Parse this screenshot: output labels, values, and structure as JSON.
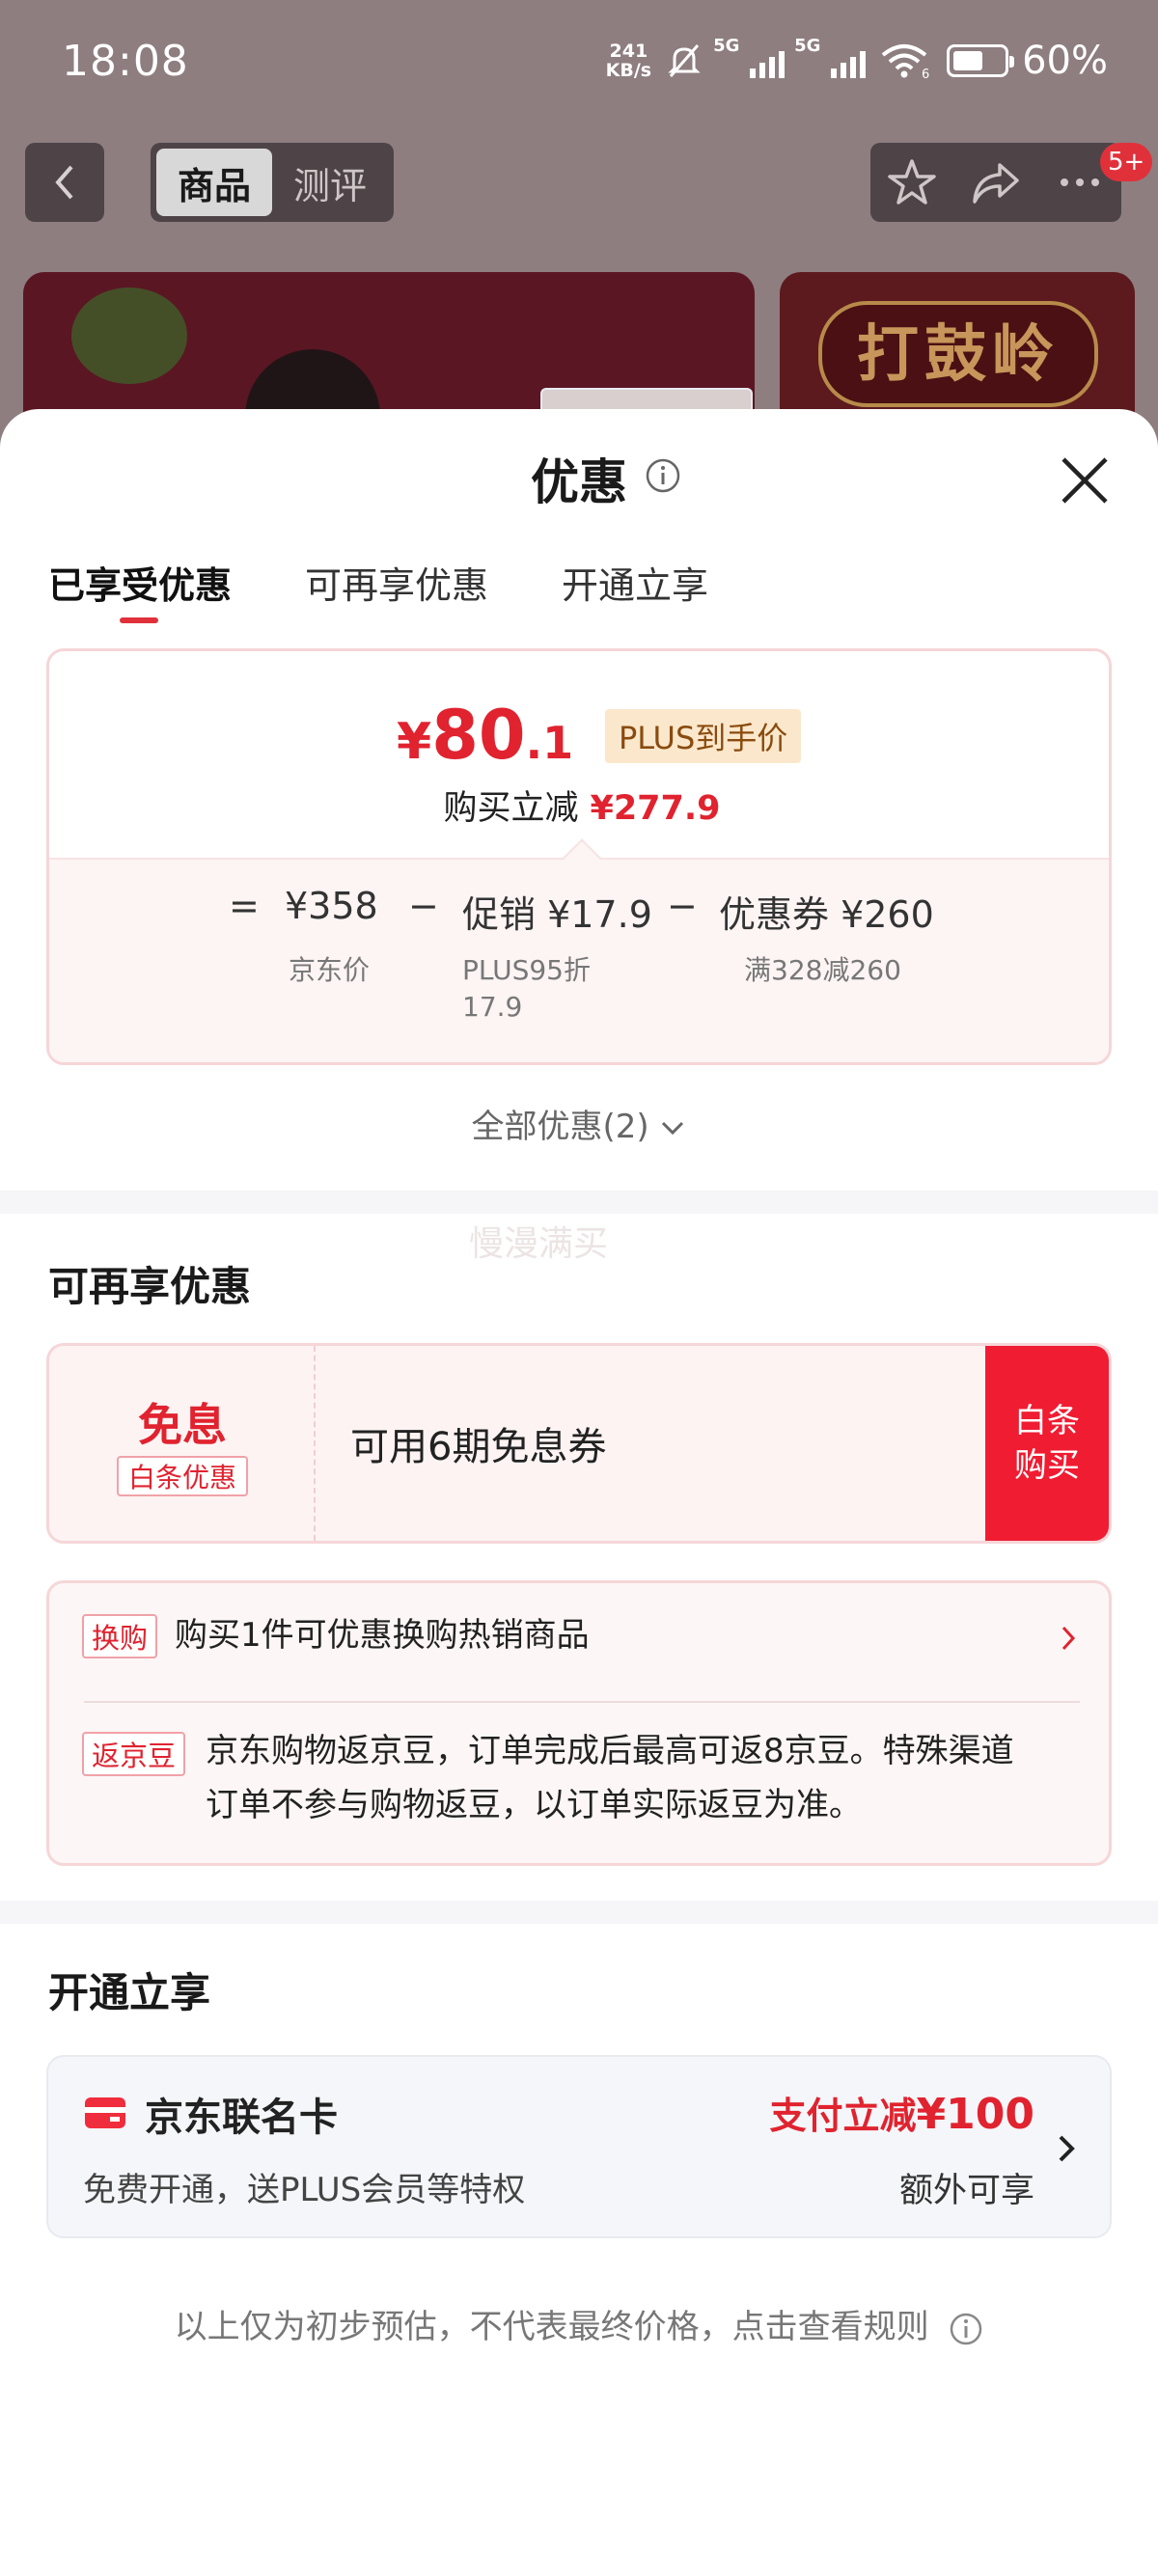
{
  "status_bar": {
    "time": "18:08",
    "net_speed_value": "241",
    "net_speed_unit": "KB/s",
    "sim1": "5G",
    "sim2": "5G",
    "wifi_sub": "6",
    "battery_percent": 60,
    "battery": "60%"
  },
  "header": {
    "tab_product": "商品",
    "tab_review": "测评",
    "badge": "5+"
  },
  "background": {
    "banner_text": "打鼓岭"
  },
  "sheet": {
    "title": "优惠",
    "tabs": [
      {
        "label": "已享受优惠"
      },
      {
        "label": "可再享优惠"
      },
      {
        "label": "开通立享"
      }
    ],
    "price": {
      "currency": "¥",
      "integer": "80",
      "decimal": ".1",
      "plus_tag": "PLUS到手价",
      "save_label": "购买立减",
      "save_amount": "¥277.9"
    },
    "breakdown": {
      "eq": "=",
      "jd_price": "¥358",
      "jd_price_label": "京东价",
      "minus1": "−",
      "promo": "促销 ¥17.9",
      "promo_detail_1": "PLUS95折",
      "promo_detail_2": "17.9",
      "minus2": "−",
      "coupon": "优惠券 ¥260",
      "coupon_detail": "满328减260"
    },
    "all_promos": "全部优惠(2)",
    "ghost_text": "慢漫满买",
    "section_more": "可再享优惠",
    "installment": {
      "title": "免息",
      "tag": "白条优惠",
      "text": "可用6期免息券",
      "button_line1": "白条",
      "button_line2": "购买"
    },
    "exchange": {
      "tag": "换购",
      "text": "购买1件可优惠换购热销商品"
    },
    "jingdou": {
      "tag": "返京豆",
      "line1": "京东购物返京豆，订单完成后最高可返8京豆。特殊渠道",
      "line2": "订单不参与购物返豆，以订单实际返豆为准。"
    },
    "section_open": "开通立享",
    "card": {
      "name": "京东联名卡",
      "desc": "免费开通，送PLUS会员等特权",
      "discount_label": "支付立减",
      "discount_amount": "¥100",
      "extra": "额外可享"
    },
    "footer": "以上仅为初步预估，不代表最终价格，点击查看规则"
  },
  "colors": {
    "accent_red": "#e0232f",
    "buy_button": "#f01c32",
    "plus_tag_bg": "#fbe8cc"
  }
}
